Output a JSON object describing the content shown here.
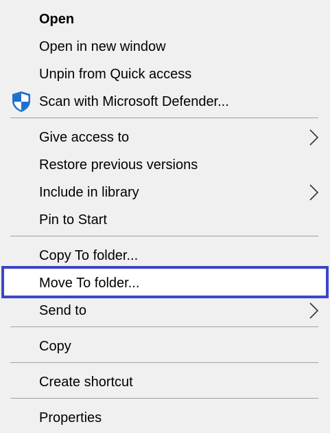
{
  "menu": {
    "items": [
      {
        "label": "Open"
      },
      {
        "label": "Open in new window"
      },
      {
        "label": "Unpin from Quick access"
      },
      {
        "label": "Scan with Microsoft Defender...",
        "icon": "windows-defender-shield-icon"
      },
      {
        "label": "Give access to",
        "submenu": true
      },
      {
        "label": "Restore previous versions"
      },
      {
        "label": "Include in library",
        "submenu": true
      },
      {
        "label": "Pin to Start"
      },
      {
        "label": "Copy To folder..."
      },
      {
        "label": "Move To folder...",
        "selected": true
      },
      {
        "label": "Send to",
        "submenu": true
      },
      {
        "label": "Copy"
      },
      {
        "label": "Create shortcut"
      },
      {
        "label": "Properties"
      }
    ]
  },
  "colors": {
    "background": "#f0f0f0",
    "separator": "#a0a0a0",
    "selection_border": "#3b46c8",
    "shield_blue": "#1e6fd0"
  }
}
